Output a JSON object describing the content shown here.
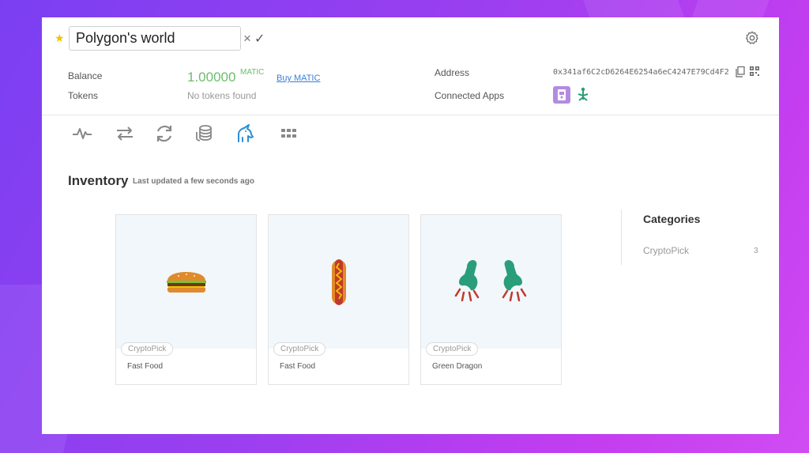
{
  "header": {
    "wallet_name": "Polygon's world",
    "clear_label": "×",
    "confirm_label": "✓"
  },
  "info": {
    "balance_label": "Balance",
    "balance_value": "1.00000",
    "balance_unit": "MATIC",
    "buy_label": "Buy MATIC",
    "tokens_label": "Tokens",
    "tokens_value": "No tokens found",
    "address_label": "Address",
    "address_value": "0x341af6C2cD6264E6254a6eC4247E79Cd4F2",
    "connected_apps_label": "Connected Apps"
  },
  "toolbar": {
    "icons": [
      "activity-icon",
      "transfer-icon",
      "refresh-icon",
      "coins-icon",
      "unicorn-icon",
      "apps-grid-icon"
    ],
    "active_color": "#2a8fd8",
    "icon_color": "#888888"
  },
  "inventory": {
    "title": "Inventory",
    "subtitle": "Last updated a few seconds ago",
    "items": [
      {
        "badge": "CryptoPick",
        "title": "Fast Food",
        "icon": "hamburger-icon"
      },
      {
        "badge": "CryptoPick",
        "title": "Fast Food",
        "icon": "hotdog-icon"
      },
      {
        "badge": "CryptoPick",
        "title": "Green Dragon",
        "icon": "dragon-claws-icon"
      }
    ]
  },
  "categories": {
    "title": "Categories",
    "items": [
      {
        "label": "CryptoPick",
        "count": "3"
      }
    ]
  },
  "colors": {
    "accent_green": "#6bbf6b",
    "link_blue": "#3a7fd5",
    "star_yellow": "#f2c200"
  }
}
